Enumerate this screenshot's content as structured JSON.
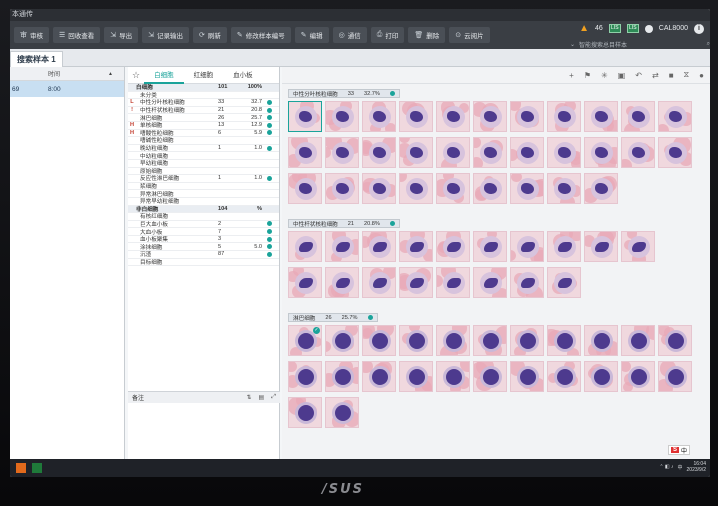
{
  "window": {
    "title": "本通传"
  },
  "toolbar": {
    "buttons": [
      {
        "icon": "审",
        "label": "审核"
      },
      {
        "icon": "☰",
        "label": "回收查看"
      },
      {
        "icon": "⇲",
        "label": "导出"
      },
      {
        "icon": "⇲",
        "label": "记录输出"
      },
      {
        "icon": "⟳",
        "label": "刷新"
      },
      {
        "icon": "✎",
        "label": "修改样本编号"
      },
      {
        "icon": "✎",
        "label": "编辑"
      },
      {
        "icon": "◎",
        "label": "通信"
      },
      {
        "icon": "⎙",
        "label": "打印"
      },
      {
        "icon": "🗑",
        "label": "删除"
      },
      {
        "icon": "⊙",
        "label": "云阅片"
      }
    ],
    "warning_count": "46",
    "user": "CAL8000",
    "search_placeholder": "智能搜索总目样本"
  },
  "sample_tab": {
    "label": "搜索样本 1"
  },
  "left_list": {
    "headers": [
      "",
      "时间"
    ],
    "rows": [
      {
        "id": "69",
        "time": "8:00"
      }
    ]
  },
  "sub_tabs": [
    "白细胞",
    "红细胞",
    "血小板"
  ],
  "wbc_table": {
    "header": {
      "name": "白细胞",
      "count": "101",
      "pct": "100%"
    },
    "rows": [
      {
        "flag": "",
        "name": "未分类",
        "count": "",
        "pct": "",
        "dot": false
      },
      {
        "flag": "L",
        "name": "中性分叶核粒细胞",
        "count": "33",
        "pct": "32.7",
        "dot": true
      },
      {
        "flag": "!",
        "name": "中性杆状核粒细胞",
        "count": "21",
        "pct": "20.8",
        "dot": true
      },
      {
        "flag": "",
        "name": "淋巴细胞",
        "count": "26",
        "pct": "25.7",
        "dot": true
      },
      {
        "flag": "H",
        "name": "单核细胞",
        "count": "13",
        "pct": "12.9",
        "dot": true
      },
      {
        "flag": "H",
        "name": "嗜酸性粒细胞",
        "count": "6",
        "pct": "5.9",
        "dot": true
      },
      {
        "flag": "",
        "name": "嗜碱性粒细胞",
        "count": "",
        "pct": "",
        "dot": false
      },
      {
        "flag": "",
        "name": "晚幼粒细胞",
        "count": "1",
        "pct": "1.0",
        "dot": true
      },
      {
        "flag": "",
        "name": "中幼粒细胞",
        "count": "",
        "pct": "",
        "dot": false
      },
      {
        "flag": "",
        "name": "早幼粒细胞",
        "count": "",
        "pct": "",
        "dot": false
      },
      {
        "flag": "",
        "name": "原始细胞",
        "count": "",
        "pct": "",
        "dot": false
      },
      {
        "flag": "",
        "name": "反应性淋巴细胞",
        "count": "1",
        "pct": "1.0",
        "dot": true
      },
      {
        "flag": "",
        "name": "浆细胞",
        "count": "",
        "pct": "",
        "dot": false
      },
      {
        "flag": "",
        "name": "异常淋巴细胞",
        "count": "",
        "pct": "",
        "dot": false
      },
      {
        "flag": "",
        "name": "异常早幼粒细胞",
        "count": "",
        "pct": "",
        "dot": false
      }
    ],
    "non_wbc_header": {
      "name": "非白细胞",
      "count": "104",
      "pct": "%"
    },
    "non_wbc_rows": [
      {
        "name": "有核红细胞",
        "count": "",
        "pct": "",
        "dot": false
      },
      {
        "name": "巨大血小板",
        "count": "2",
        "pct": "",
        "dot": true
      },
      {
        "name": "大血小板",
        "count": "7",
        "pct": "",
        "dot": true
      },
      {
        "name": "血小板聚集",
        "count": "3",
        "pct": "",
        "dot": true
      },
      {
        "name": "涂抹细胞",
        "count": "5",
        "pct": "5.0",
        "dot": true
      },
      {
        "name": "沉渣",
        "count": "87",
        "pct": "",
        "dot": true
      },
      {
        "name": "目标细胞",
        "count": "",
        "pct": "",
        "dot": false
      }
    ]
  },
  "note": {
    "label": "备注"
  },
  "groups": [
    {
      "name": "中性分叶核粒细胞",
      "count": "33",
      "pct": "32.7%"
    },
    {
      "name": "中性杆状核粒细胞",
      "count": "21",
      "pct": "20.8%"
    },
    {
      "name": "淋巴细胞",
      "count": "26",
      "pct": "25.7%"
    }
  ],
  "taskbar": {
    "time": "16:04",
    "date": "2023/9/2",
    "ime": "中"
  },
  "monitor_brand": "/SUS"
}
